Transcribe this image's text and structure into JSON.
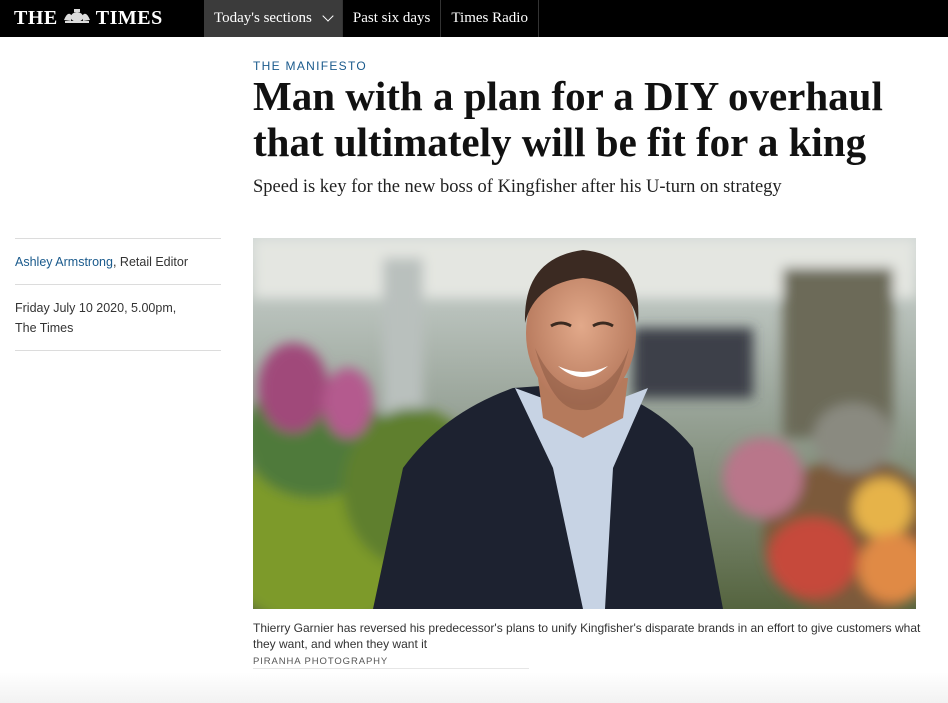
{
  "masthead": {
    "logo_left": "THE",
    "logo_right": "TIMES",
    "crest_icon": "royal-crest"
  },
  "nav": {
    "items": [
      {
        "label": "Today's sections",
        "active": true
      },
      {
        "label": "Past six days",
        "active": false
      },
      {
        "label": "Times Radio",
        "active": false
      }
    ]
  },
  "article": {
    "kicker": "THE MANIFESTO",
    "headline": "Man with a plan for a DIY overhaul that ultimately will be fit for a king",
    "standfirst": "Speed is key for the new boss of Kingfisher after his U-turn on strategy",
    "author_name": "Ashley Armstrong",
    "author_role": ", Retail Editor",
    "date": "Friday July 10 2020, 5.00pm,",
    "publication": "The Times",
    "caption": "Thierry Garnier has reversed his predecessor's plans to unify Kingfisher's disparate brands in an effort to give customers what they want, and when they want it",
    "photo_credit": "PIRANHA PHOTOGRAPHY"
  },
  "colors": {
    "masthead_bg": "#000000",
    "active_tab_bg": "#3b3b3b",
    "link_blue": "#1a5a8c"
  }
}
